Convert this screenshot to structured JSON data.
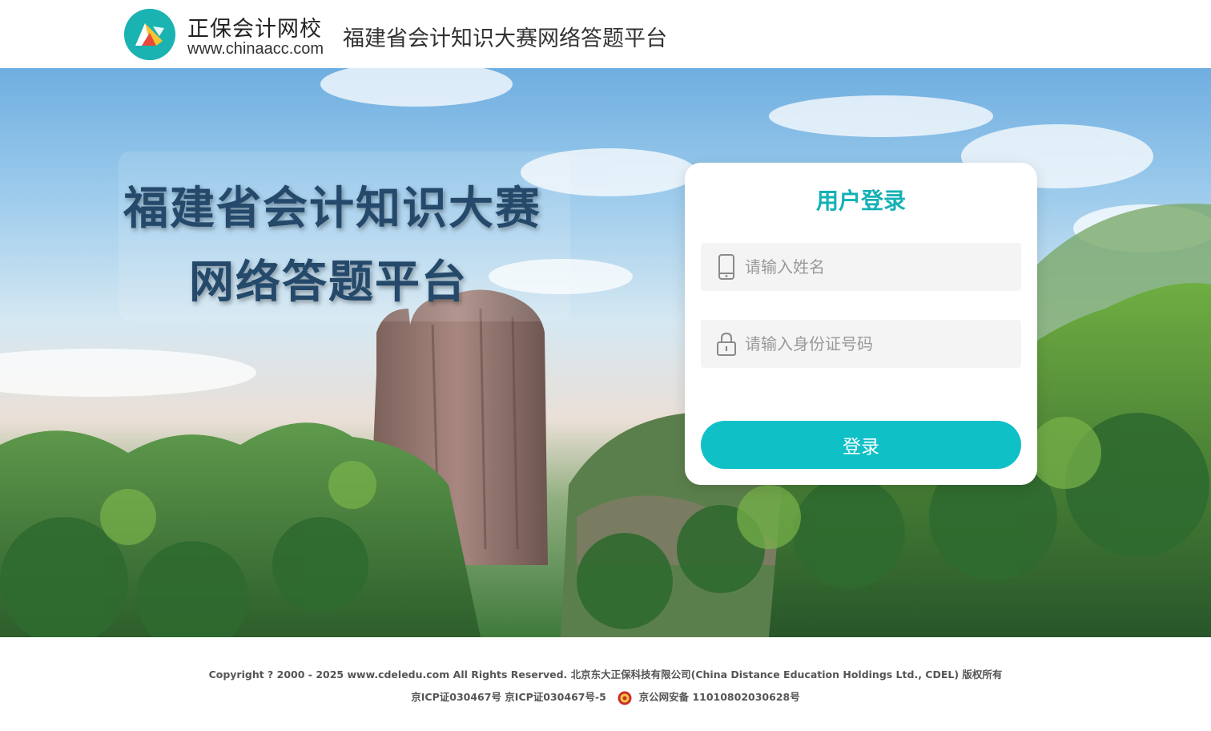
{
  "header": {
    "logo_name": "正保会计网校",
    "logo_url": "www.chinaacc.com",
    "title": "福建省会计知识大赛网络答题平台"
  },
  "hero": {
    "title_line1": "福建省会计知识大赛",
    "title_line2": "网络答题平台"
  },
  "login": {
    "title": "用户登录",
    "name_placeholder": "请输入姓名",
    "name_value": "",
    "id_placeholder": "请输入身份证号码",
    "id_value": "",
    "submit_label": "登录"
  },
  "footer": {
    "copyright": "Copyright ? 2000 - 2025 www.cdeledu.com All Rights Reserved.    北京东大正保科技有限公司(China Distance Education Holdings Ltd., CDEL) 版权所有",
    "icp": "京ICP证030467号 京ICP证030467号-5",
    "police": "京公网安备 11010802030628号"
  },
  "colors": {
    "accent": "#10c0c7",
    "login_title": "#14b1b6",
    "hero_title": "#24496b",
    "logo_teal": "#1bb3b1"
  },
  "icons": {
    "logo": "chinaacc-logo-icon",
    "name_field": "mobile-phone-icon",
    "id_field": "lock-icon",
    "police": "police-badge-icon"
  }
}
